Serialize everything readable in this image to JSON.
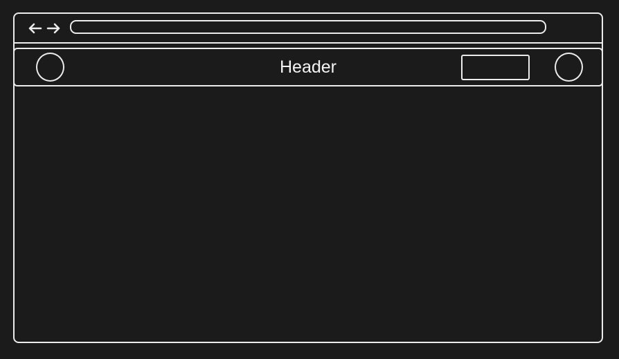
{
  "window": {
    "nav_icon": "back-forward-arrows-icon"
  },
  "header": {
    "title": "Header",
    "left_icon": "circle-icon",
    "right_icon": "circle-icon"
  },
  "colors": {
    "background": "#1b1b1b",
    "stroke": "#ececec",
    "text": "#f4f4f4"
  }
}
